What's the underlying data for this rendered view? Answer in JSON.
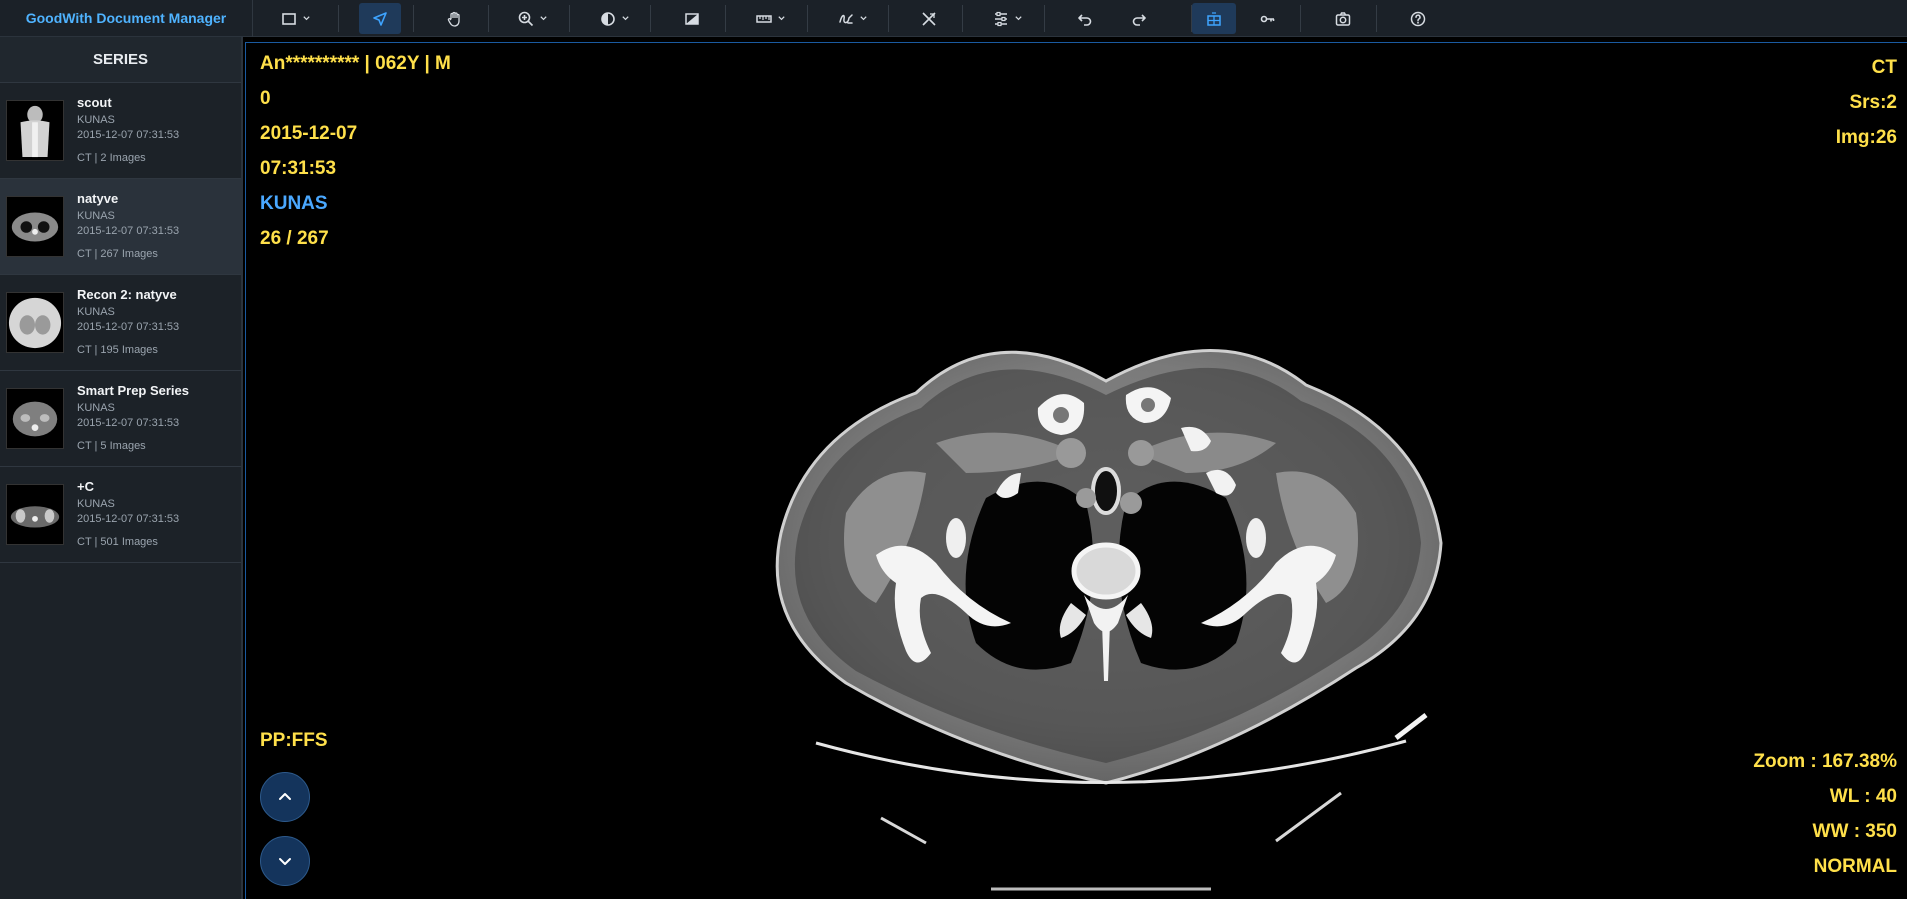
{
  "app": {
    "title": "GoodWith Document Manager"
  },
  "toolbar": {
    "tools": [
      {
        "name": "rectangle-select-tool",
        "icon": "square-icon",
        "has_menu": true
      },
      {
        "name": "pointer-tool",
        "icon": "cursor-arrow-icon",
        "has_menu": false,
        "active": true
      },
      {
        "name": "pan-tool",
        "icon": "hand-icon",
        "has_menu": false
      },
      {
        "name": "zoom-tool",
        "icon": "magnifier-plus-icon",
        "has_menu": true
      },
      {
        "name": "window-level-tool",
        "icon": "contrast-icon",
        "has_menu": true
      },
      {
        "name": "invert-tool",
        "icon": "invert-icon",
        "has_menu": false
      },
      {
        "name": "measure-tool",
        "icon": "ruler-icon",
        "has_menu": true
      },
      {
        "name": "annotate-tool",
        "icon": "freehand-icon",
        "has_menu": true
      },
      {
        "name": "clear-annotations-tool",
        "icon": "eraser-cross-icon",
        "has_menu": false
      },
      {
        "name": "adjust-tool",
        "icon": "sliders-icon",
        "has_menu": true
      },
      {
        "name": "undo-tool",
        "icon": "undo-icon",
        "has_menu": false
      },
      {
        "name": "redo-tool",
        "icon": "redo-icon",
        "has_menu": false
      },
      {
        "name": "layout-tool",
        "icon": "grid-layout-icon",
        "has_menu": false,
        "active": true
      },
      {
        "name": "link-tool",
        "icon": "key-link-icon",
        "has_menu": false
      },
      {
        "name": "screenshot-tool",
        "icon": "camera-icon",
        "has_menu": false
      },
      {
        "name": "help-tool",
        "icon": "help-circle-icon",
        "has_menu": false
      }
    ]
  },
  "sidebar": {
    "header": "SERIES",
    "series": [
      {
        "name": "scout",
        "institution": "KUNAS",
        "datetime": "2015-12-07 07:31:53",
        "count": "CT | 2 Images",
        "thumb": "scout-thumb",
        "active": false
      },
      {
        "name": "natyve",
        "institution": "KUNAS",
        "datetime": "2015-12-07 07:31:53",
        "count": "CT | 267 Images",
        "thumb": "axial-thumb",
        "active": true
      },
      {
        "name": "Recon 2: natyve",
        "institution": "KUNAS",
        "datetime": "2015-12-07 07:31:53",
        "count": "CT | 195 Images",
        "thumb": "lung-thumb",
        "active": false
      },
      {
        "name": "Smart Prep Series",
        "institution": "KUNAS",
        "datetime": "2015-12-07 07:31:53",
        "count": "CT | 5 Images",
        "thumb": "abdomen-thumb",
        "active": false
      },
      {
        "name": "+C",
        "institution": "KUNAS",
        "datetime": "2015-12-07 07:31:53",
        "count": "CT | 501 Images",
        "thumb": "pelvis-thumb",
        "active": false
      }
    ]
  },
  "viewer": {
    "top_left": {
      "patient": "An********** | 062Y | M",
      "patient_id": "0",
      "study_date": "2015-12-07",
      "study_time": "07:31:53",
      "institution": "KUNAS",
      "image_position": "26 / 267"
    },
    "top_right": {
      "modality": "CT",
      "series": "Srs:2",
      "image": "Img:26"
    },
    "bottom_left": {
      "patient_position": "PP:FFS"
    },
    "bottom_right": {
      "zoom": "Zoom : 167.38%",
      "window_level": "WL : 40",
      "window_width": "WW : 350",
      "display_mode": "NORMAL"
    },
    "nav": {
      "prev_icon": "chevron-up-icon",
      "next_icon": "chevron-down-icon"
    }
  },
  "colors": {
    "overlay_text": "#ffe04a",
    "institution_text": "#4aa8ff",
    "accent": "#3ea4ff",
    "app_title": "#4fb3ff",
    "toolbar_bg": "#1b2128",
    "sidebar_bg": "#1c2228"
  }
}
